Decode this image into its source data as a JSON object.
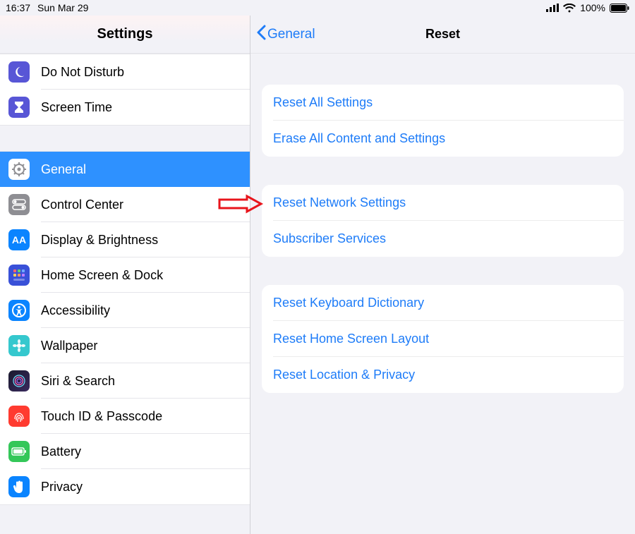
{
  "statusbar": {
    "time": "16:37",
    "date": "Sun Mar 29",
    "battery_pct": "100%"
  },
  "sidebar": {
    "title": "Settings",
    "group_a": [
      {
        "id": "dnd",
        "label": "Do Not Disturb",
        "icon": "moon",
        "bg": "#5856d6"
      },
      {
        "id": "screen-time",
        "label": "Screen Time",
        "icon": "hourglass",
        "bg": "#5856d6"
      }
    ],
    "group_b": [
      {
        "id": "general",
        "label": "General",
        "icon": "gear",
        "bg": "#8e8e93",
        "selected": true
      },
      {
        "id": "control-center",
        "label": "Control Center",
        "icon": "switches",
        "bg": "#8e8e93"
      },
      {
        "id": "display",
        "label": "Display & Brightness",
        "icon": "aa",
        "bg": "#0a84ff"
      },
      {
        "id": "home-dock",
        "label": "Home Screen & Dock",
        "icon": "grid",
        "bg": "#3951d8"
      },
      {
        "id": "accessibility",
        "label": "Accessibility",
        "icon": "person-circle",
        "bg": "#0a84ff"
      },
      {
        "id": "wallpaper",
        "label": "Wallpaper",
        "icon": "flower",
        "bg": "#35c8ce"
      },
      {
        "id": "siri",
        "label": "Siri & Search",
        "icon": "siri",
        "bg": "#000"
      },
      {
        "id": "touchid",
        "label": "Touch ID & Passcode",
        "icon": "fingerprint",
        "bg": "#ff3b30"
      },
      {
        "id": "battery",
        "label": "Battery",
        "icon": "battery",
        "bg": "#34c759"
      },
      {
        "id": "privacy",
        "label": "Privacy",
        "icon": "hand",
        "bg": "#0a84ff"
      }
    ]
  },
  "detail": {
    "back_label": "General",
    "title": "Reset",
    "groups": [
      [
        {
          "id": "reset-all",
          "label": "Reset All Settings"
        },
        {
          "id": "erase-all",
          "label": "Erase All Content and Settings"
        }
      ],
      [
        {
          "id": "reset-network",
          "label": "Reset Network Settings",
          "highlighted": true
        },
        {
          "id": "subscriber",
          "label": "Subscriber Services"
        }
      ],
      [
        {
          "id": "reset-keyboard",
          "label": "Reset Keyboard Dictionary"
        },
        {
          "id": "reset-home",
          "label": "Reset Home Screen Layout"
        },
        {
          "id": "reset-location",
          "label": "Reset Location & Privacy"
        }
      ]
    ]
  }
}
